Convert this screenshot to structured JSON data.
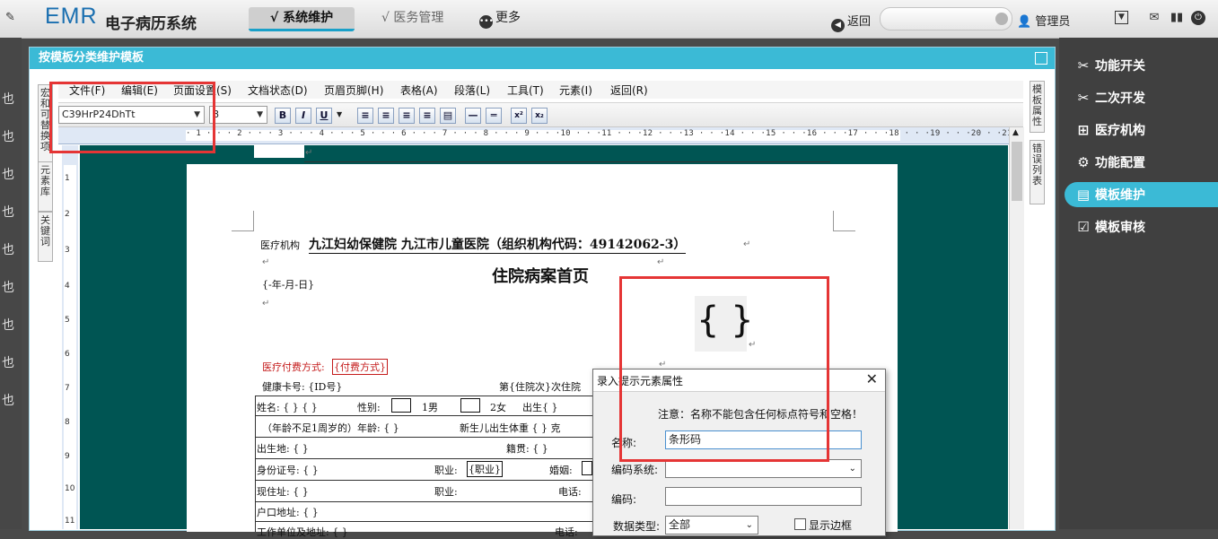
{
  "app": {
    "logo": "EMR",
    "logo_sub": "电子病历系统",
    "pin_icon": "pin-icon"
  },
  "topnav": {
    "system": "√ 系统维护",
    "medical": "√ 医务管理",
    "more": "更多",
    "back": "返回",
    "user": "管理员"
  },
  "left_strip_chars": [
    "也",
    "也",
    "也",
    "也",
    "也",
    "也",
    "也",
    "也",
    "也"
  ],
  "panel": {
    "title": "按模板分类维护模板"
  },
  "left_tabs": [
    "宏和可替换项",
    "元素库",
    "关键词"
  ],
  "right_tabs": [
    "模板属性",
    "错误列表"
  ],
  "menu": [
    "文件(F)",
    "编辑(E)",
    "页面设置(S)",
    "文档状态(D)",
    "页眉页脚(H)",
    "表格(A)",
    "段落(L)",
    "工具(T)",
    "元素(I)",
    "返回(R)"
  ],
  "toolbar": {
    "font_value": "C39HrP24DhTt",
    "size_value": "8",
    "bold": "B",
    "italic": "I",
    "underline": "U",
    "sup": "x²",
    "sub": "x₂"
  },
  "ruler": {
    "text": "· 1 · · · 2 · · · 3 · · · 4 · · · 5 · · · 6 · · · 7 · · · 8 · · · 9 · · ·10 · · ·11 · · ·12 · · ·13 · · ·14 · · ·15 · · ·16 · · ·17 · · ·18 · · ·19 · · ·20 · ·21 ·"
  },
  "vruler_nums": [
    "1",
    "2",
    "3",
    "4",
    "5",
    "6",
    "7",
    "8",
    "9",
    "10",
    "11"
  ],
  "doc": {
    "org_label": "医疗机构",
    "org_name": "九江妇幼保健院 九江市儿童医院（组织机构代码：49142062-3）",
    "doc_title": "住院病案首页",
    "date": "{-年-月-日}",
    "barcode_glyph": "{ }",
    "pay_label": "医疗付费方式:",
    "pay_field": "{付费方式}",
    "health_card": "健康卡号: {ID号}",
    "visit": "第{住院次}次住院",
    "r1a": "姓名: {  }    {  }",
    "r1b": "性别:",
    "r1c": "1男",
    "r1d": "2女",
    "r1e": "出生{ }",
    "r2a": "（年龄不足1周岁的）年龄: { }",
    "r2b": "新生儿出生体重  { } 克",
    "r3a": "出生地: { }",
    "r3b": "籍贯: { }",
    "r4a": "身份证号: { }",
    "r4b": "职业:",
    "r4c": "{职业}",
    "r4d": "婚姻:",
    "r5a": "现住址: { }",
    "r5b": "职业:",
    "r5c": "电话:",
    "r6a": "户口地址: { }",
    "r7a": "工作单位及地址: { }",
    "r7b": "电话:"
  },
  "right_menu": [
    {
      "label": "功能开关",
      "icon": "tools-icon"
    },
    {
      "label": "二次开发",
      "icon": "wrench-icon"
    },
    {
      "label": "医疗机构",
      "icon": "hospital-icon"
    },
    {
      "label": "功能配置",
      "icon": "gears-icon"
    },
    {
      "label": "模板维护",
      "icon": "template-icon"
    },
    {
      "label": "模板审核",
      "icon": "review-icon"
    }
  ],
  "dialog": {
    "title": "录入提示元素属性",
    "notice": "注意：名称不能包含任何标点符号和空格！",
    "name_label": "名称:",
    "name_value": "条形码",
    "code_system_label": "编码系统:",
    "code_label": "编码:",
    "data_type_label": "数据类型:",
    "data_type_value": "全部",
    "border_label": "显示边框"
  },
  "colors": {
    "accent": "#3bbad6",
    "doc_bg": "#005553",
    "highlight": "#e53535"
  }
}
